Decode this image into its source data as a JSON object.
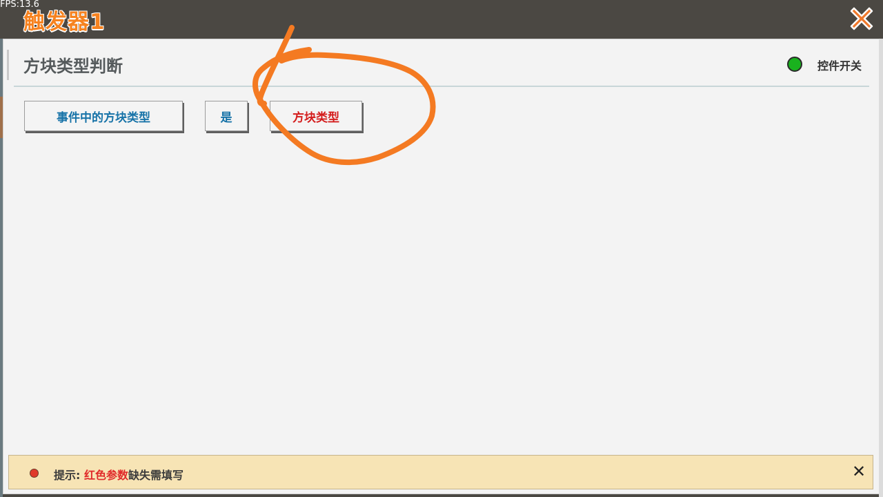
{
  "overlay": {
    "fps": "FPS:13.6"
  },
  "window": {
    "title": "触发器1"
  },
  "section": {
    "title": "方块类型判断"
  },
  "control_toggle": {
    "label": "控件开关",
    "state": "on",
    "color": "#19b21e"
  },
  "condition": {
    "left_operand": "事件中的方块类型",
    "operator": "是",
    "right_operand": "方块类型",
    "right_operand_color": "#d41c1c"
  },
  "hint": {
    "prefix": "提示: ",
    "highlight": "红色参数",
    "suffix": "缺失需填写",
    "close_label": "✕"
  },
  "colors": {
    "title": "#f6821f",
    "param_blue": "#1773a8",
    "param_missing_red": "#d41c1c",
    "annotation_orange": "#f47a22"
  },
  "icons": {
    "close": "close-icon",
    "toggle": "status-dot-icon"
  }
}
